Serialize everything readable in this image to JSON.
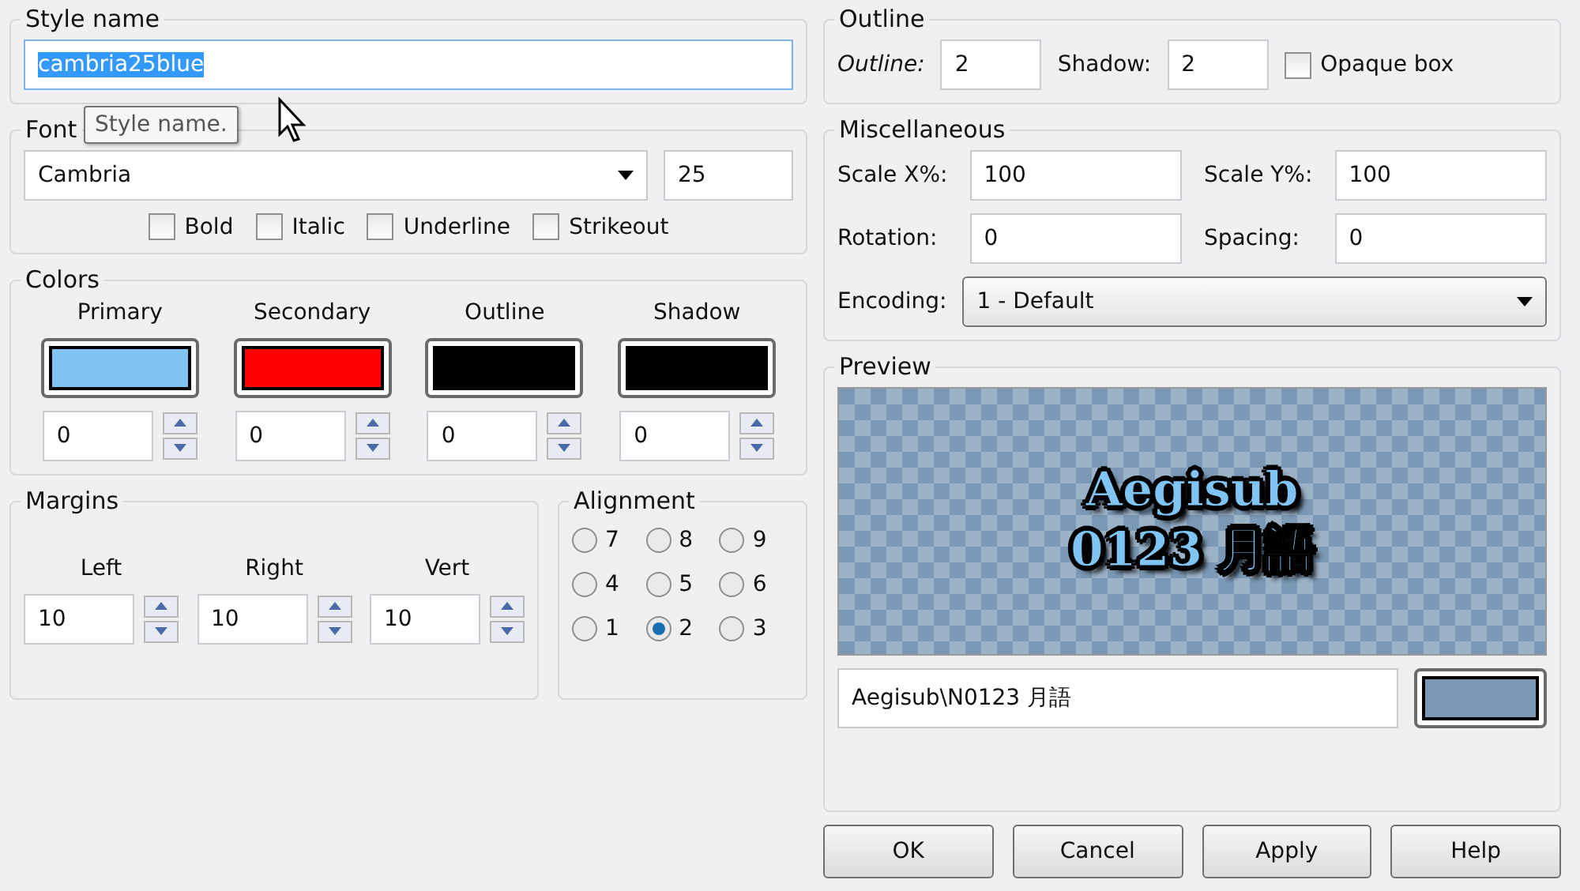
{
  "style_name": {
    "label": "Style name",
    "value": "cambria25blue",
    "tooltip": "Style name."
  },
  "font": {
    "label": "Font",
    "family": "Cambria",
    "size": "25",
    "options": [
      {
        "label": "Bold",
        "checked": false
      },
      {
        "label": "Italic",
        "checked": false
      },
      {
        "label": "Underline",
        "checked": false
      },
      {
        "label": "Strikeout",
        "checked": false
      }
    ]
  },
  "colors": {
    "label": "Colors",
    "items": [
      {
        "label": "Primary",
        "color": "#80c4f4",
        "alpha": "0"
      },
      {
        "label": "Secondary",
        "color": "#ff0000",
        "alpha": "0"
      },
      {
        "label": "Outline",
        "color": "#000000",
        "alpha": "0"
      },
      {
        "label": "Shadow",
        "color": "#000000",
        "alpha": "0"
      }
    ]
  },
  "margins": {
    "label": "Margins",
    "items": [
      {
        "label": "Left",
        "value": "10"
      },
      {
        "label": "Right",
        "value": "10"
      },
      {
        "label": "Vert",
        "value": "10"
      }
    ]
  },
  "alignment": {
    "label": "Alignment",
    "options": [
      {
        "label": "7",
        "selected": false
      },
      {
        "label": "8",
        "selected": false
      },
      {
        "label": "9",
        "selected": false
      },
      {
        "label": "4",
        "selected": false
      },
      {
        "label": "5",
        "selected": false
      },
      {
        "label": "6",
        "selected": false
      },
      {
        "label": "1",
        "selected": false
      },
      {
        "label": "2",
        "selected": true
      },
      {
        "label": "3",
        "selected": false
      }
    ]
  },
  "outline": {
    "label": "Outline",
    "outline_label": "Outline:",
    "outline": "2",
    "shadow_label": "Shadow:",
    "shadow": "2",
    "opaque_box": {
      "label": "Opaque box",
      "checked": false
    }
  },
  "misc": {
    "label": "Miscellaneous",
    "fields": [
      {
        "label": "Scale X%:",
        "value": "100"
      },
      {
        "label": "Scale Y%:",
        "value": "100"
      },
      {
        "label": "Rotation:",
        "value": "0"
      },
      {
        "label": "Spacing:",
        "value": "0"
      }
    ],
    "encoding_label": "Encoding:",
    "encoding": "1 - Default"
  },
  "preview": {
    "label": "Preview",
    "line1": "Aegisub",
    "line2": "0123 月語",
    "text": "Aegisub\\N0123 月語",
    "color": "#7b98b4"
  },
  "buttons": [
    {
      "label": "OK"
    },
    {
      "label": "Cancel"
    },
    {
      "label": "Apply"
    },
    {
      "label": "Help"
    }
  ]
}
